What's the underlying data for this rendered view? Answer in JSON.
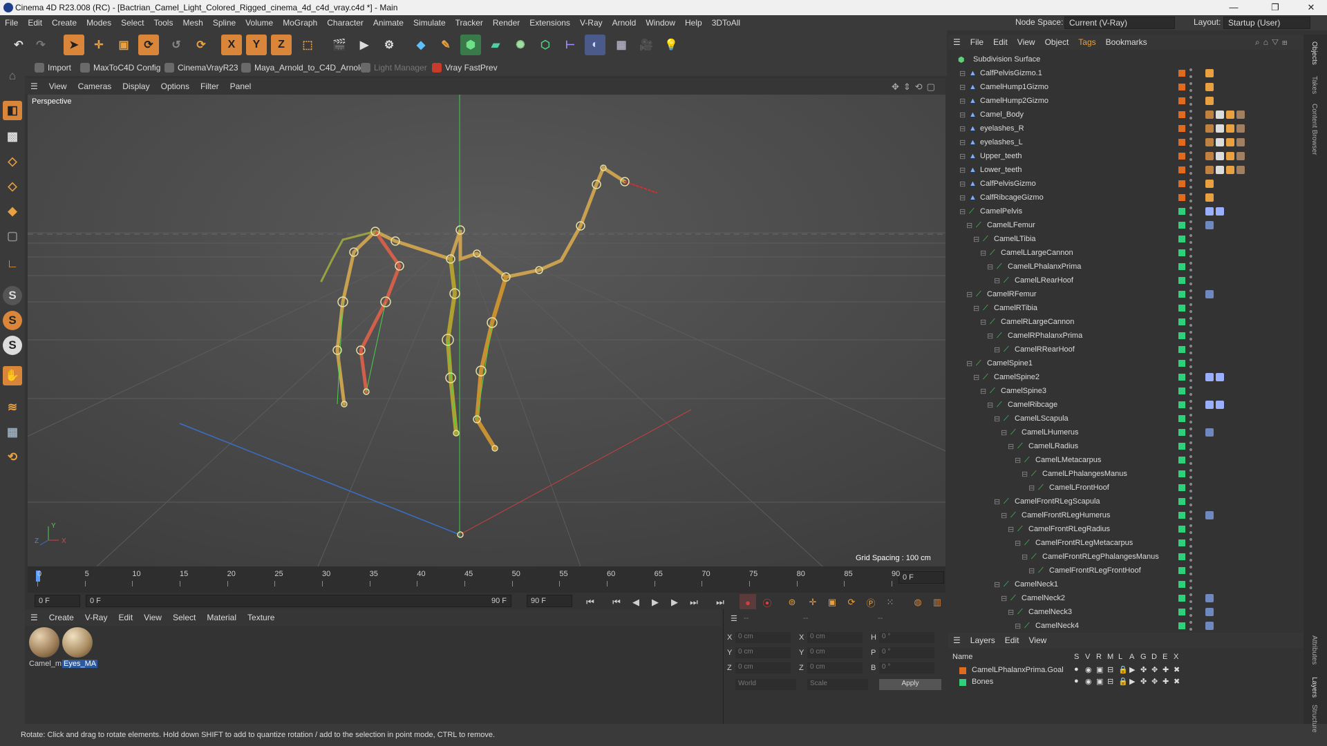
{
  "window": {
    "title": "Cinema 4D R23.008 (RC) - [Bactrian_Camel_Light_Colored_Rigged_cinema_4d_c4d_vray.c4d *] - Main",
    "minimize": "—",
    "maximize": "❐",
    "close": "✕"
  },
  "menubar": {
    "items": [
      "File",
      "Edit",
      "Create",
      "Modes",
      "Select",
      "Tools",
      "Mesh",
      "Spline",
      "Volume",
      "MoGraph",
      "Character",
      "Animate",
      "Simulate",
      "Tracker",
      "Render",
      "Extensions",
      "V-Ray",
      "Arnold",
      "Window",
      "Help",
      "3DToAll"
    ],
    "node_space_label": "Node Space:",
    "node_space_value": "Current (V-Ray)",
    "layout_label": "Layout:",
    "layout_value": "Startup (User)"
  },
  "plugins": [
    "Import",
    "MaxToC4D Config",
    "CinemaVrayR23",
    "Maya_Arnold_to_C4D_Arnold",
    "Light Manager",
    "Vray FastPrev"
  ],
  "viewport": {
    "menu": [
      "View",
      "Cameras",
      "Display",
      "Options",
      "Filter",
      "Panel"
    ],
    "label": "Perspective",
    "grid_spacing": "Grid Spacing : 100 cm",
    "axis_y": "Y",
    "axis_z": "Z",
    "axis_x": "X"
  },
  "timeline": {
    "ticks": [
      "0",
      "5",
      "10",
      "15",
      "20",
      "25",
      "30",
      "35",
      "40",
      "45",
      "50",
      "55",
      "60",
      "65",
      "70",
      "75",
      "80",
      "85",
      "90"
    ],
    "current_frame_right": "0 F",
    "start_field": "0 F",
    "range_start": "0 F",
    "range_end": "90 F",
    "end_field": "90 F"
  },
  "material_manager": {
    "menu": [
      "Create",
      "V-Ray",
      "Edit",
      "View",
      "Select",
      "Material",
      "Texture"
    ],
    "materials": [
      {
        "label": "Camel_m"
      },
      {
        "label": "Eyes_MA"
      }
    ]
  },
  "coordinates": {
    "header_dashes": [
      "--",
      "--",
      "--"
    ],
    "rows": [
      {
        "a": "X",
        "av": "0 cm",
        "b": "X",
        "bv": "0 cm",
        "c": "H",
        "cv": "0 °"
      },
      {
        "a": "Y",
        "av": "0 cm",
        "b": "Y",
        "bv": "0 cm",
        "c": "P",
        "cv": "0 °"
      },
      {
        "a": "Z",
        "av": "0 cm",
        "b": "Z",
        "bv": "0 cm",
        "c": "B",
        "cv": "0 °"
      }
    ],
    "space": "World",
    "mode": "Scale",
    "apply": "Apply"
  },
  "status": "Rotate: Click and drag to rotate elements. Hold down SHIFT to add to quantize rotation / add to the selection in point mode, CTRL to remove.",
  "object_manager": {
    "menu": [
      "File",
      "Edit",
      "View",
      "Object",
      "Tags",
      "Bookmarks"
    ],
    "root": "Subdivision Surface",
    "items": [
      {
        "name": "CalfPelvisGizmo.1",
        "indent": 1,
        "color": "#e06a1e",
        "kind": "null"
      },
      {
        "name": "CamelHump1Gizmo",
        "indent": 1,
        "color": "#e06a1e",
        "kind": "null"
      },
      {
        "name": "CamelHump2Gizmo",
        "indent": 1,
        "color": "#e06a1e",
        "kind": "null"
      },
      {
        "name": "Camel_Body",
        "indent": 1,
        "color": "#e06a1e",
        "kind": "mesh"
      },
      {
        "name": "eyelashes_R",
        "indent": 1,
        "color": "#e06a1e",
        "kind": "mesh"
      },
      {
        "name": "eyelashes_L",
        "indent": 1,
        "color": "#e06a1e",
        "kind": "mesh"
      },
      {
        "name": "Upper_teeth",
        "indent": 1,
        "color": "#e06a1e",
        "kind": "mesh"
      },
      {
        "name": "Lower_teeth",
        "indent": 1,
        "color": "#e06a1e",
        "kind": "mesh"
      },
      {
        "name": "CalfPelvisGizmo",
        "indent": 1,
        "color": "#e06a1e",
        "kind": "null"
      },
      {
        "name": "CalfRibcageGizmo",
        "indent": 1,
        "color": "#e06a1e",
        "kind": "null"
      },
      {
        "name": "CamelPelvis",
        "indent": 1,
        "color": "#2ed17a",
        "kind": "joint2"
      },
      {
        "name": "CamelLFemur",
        "indent": 2,
        "color": "#2ed17a",
        "kind": "joint1"
      },
      {
        "name": "CamelLTibia",
        "indent": 3,
        "color": "#2ed17a",
        "kind": "joint"
      },
      {
        "name": "CamelLLargeCannon",
        "indent": 4,
        "color": "#2ed17a",
        "kind": "joint"
      },
      {
        "name": "CamelLPhalanxPrima",
        "indent": 5,
        "color": "#2ed17a",
        "kind": "joint"
      },
      {
        "name": "CamelLRearHoof",
        "indent": 6,
        "color": "#2ed17a",
        "kind": "joint"
      },
      {
        "name": "CamelRFemur",
        "indent": 2,
        "color": "#2ed17a",
        "kind": "joint1"
      },
      {
        "name": "CamelRTibia",
        "indent": 3,
        "color": "#2ed17a",
        "kind": "joint"
      },
      {
        "name": "CamelRLargeCannon",
        "indent": 4,
        "color": "#2ed17a",
        "kind": "joint"
      },
      {
        "name": "CamelRPhalanxPrima",
        "indent": 5,
        "color": "#2ed17a",
        "kind": "joint"
      },
      {
        "name": "CamelRRearHoof",
        "indent": 6,
        "color": "#2ed17a",
        "kind": "joint"
      },
      {
        "name": "CamelSpine1",
        "indent": 2,
        "color": "#2ed17a",
        "kind": "joint"
      },
      {
        "name": "CamelSpine2",
        "indent": 3,
        "color": "#2ed17a",
        "kind": "joint2"
      },
      {
        "name": "CamelSpine3",
        "indent": 4,
        "color": "#2ed17a",
        "kind": "joint"
      },
      {
        "name": "CamelRibcage",
        "indent": 5,
        "color": "#2ed17a",
        "kind": "joint2"
      },
      {
        "name": "CamelLScapula",
        "indent": 6,
        "color": "#2ed17a",
        "kind": "joint"
      },
      {
        "name": "CamelLHumerus",
        "indent": 7,
        "color": "#2ed17a",
        "kind": "joint1"
      },
      {
        "name": "CamelLRadius",
        "indent": 8,
        "color": "#2ed17a",
        "kind": "joint"
      },
      {
        "name": "CamelLMetacarpus",
        "indent": 9,
        "color": "#2ed17a",
        "kind": "joint"
      },
      {
        "name": "CamelLPhalangesManus",
        "indent": 10,
        "color": "#2ed17a",
        "kind": "joint"
      },
      {
        "name": "CamelLFrontHoof",
        "indent": 11,
        "color": "#2ed17a",
        "kind": "joint"
      },
      {
        "name": "CamelFrontRLegScapula",
        "indent": 6,
        "color": "#2ed17a",
        "kind": "joint"
      },
      {
        "name": "CamelFrontRLegHumerus",
        "indent": 7,
        "color": "#2ed17a",
        "kind": "joint1"
      },
      {
        "name": "CamelFrontRLegRadius",
        "indent": 8,
        "color": "#2ed17a",
        "kind": "joint"
      },
      {
        "name": "CamelFrontRLegMetacarpus",
        "indent": 9,
        "color": "#2ed17a",
        "kind": "joint"
      },
      {
        "name": "CamelFrontRLegPhalangesManus",
        "indent": 10,
        "color": "#2ed17a",
        "kind": "joint"
      },
      {
        "name": "CamelFrontRLegFrontHoof",
        "indent": 11,
        "color": "#2ed17a",
        "kind": "joint"
      },
      {
        "name": "CamelNeck1",
        "indent": 6,
        "color": "#2ed17a",
        "kind": "joint"
      },
      {
        "name": "CamelNeck2",
        "indent": 7,
        "color": "#2ed17a",
        "kind": "joint1"
      },
      {
        "name": "CamelNeck3",
        "indent": 8,
        "color": "#2ed17a",
        "kind": "joint1"
      },
      {
        "name": "CamelNeck4",
        "indent": 9,
        "color": "#2ed17a",
        "kind": "joint1"
      }
    ]
  },
  "layers": {
    "menu": [
      "Layers",
      "Edit",
      "View"
    ],
    "head_name": "Name",
    "columns": [
      "S",
      "V",
      "R",
      "M",
      "L",
      "A",
      "G",
      "D",
      "E",
      "X"
    ],
    "rows": [
      {
        "name": "CamelLPhalanxPrima.Goal",
        "color": "#e06a1e"
      },
      {
        "name": "Bones",
        "color": "#2ed17a"
      }
    ]
  },
  "side_tabs": [
    "Objects",
    "Takes",
    "Content Browser",
    "Attributes",
    "Layers",
    "Structure"
  ]
}
